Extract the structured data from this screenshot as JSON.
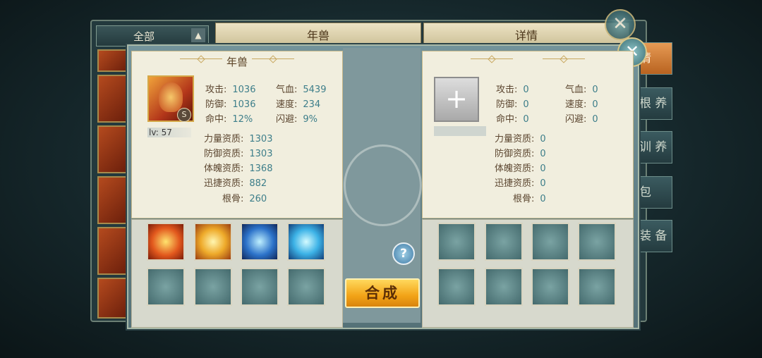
{
  "background": {
    "filter_label": "全部",
    "tab_left": "年兽",
    "tab_right": "详情",
    "side_buttons": [
      "情",
      "根 养",
      "训 养",
      "包",
      "装 备"
    ]
  },
  "left_panel": {
    "title": "年兽",
    "level": "lv: 57",
    "rank": "S",
    "stats": [
      {
        "label": "攻击:",
        "value": "1036"
      },
      {
        "label": "气血:",
        "value": "5439"
      },
      {
        "label": "防御:",
        "value": "1036"
      },
      {
        "label": "速度:",
        "value": "234"
      },
      {
        "label": "命中:",
        "value": "12%"
      },
      {
        "label": "闪避:",
        "value": "9%"
      }
    ],
    "aptitudes": [
      {
        "label": "力量资质:",
        "value": "1303"
      },
      {
        "label": "防御资质:",
        "value": "1303"
      },
      {
        "label": "体魄资质:",
        "value": "1368"
      },
      {
        "label": "迅捷资质:",
        "value": "882"
      },
      {
        "label": "根骨:",
        "value": "260"
      }
    ]
  },
  "right_panel": {
    "add_icon": "+",
    "stats": [
      {
        "label": "攻击:",
        "value": "0"
      },
      {
        "label": "气血:",
        "value": "0"
      },
      {
        "label": "防御:",
        "value": "0"
      },
      {
        "label": "速度:",
        "value": "0"
      },
      {
        "label": "命中:",
        "value": "0"
      },
      {
        "label": "闪避:",
        "value": "0"
      }
    ],
    "aptitudes": [
      {
        "label": "力量资质:",
        "value": "0"
      },
      {
        "label": "防御资质:",
        "value": "0"
      },
      {
        "label": "体魄资质:",
        "value": "0"
      },
      {
        "label": "迅捷资质:",
        "value": "0"
      },
      {
        "label": "根骨:",
        "value": "0"
      }
    ]
  },
  "center": {
    "help_label": "?",
    "combine_label": "合成"
  },
  "close_label": "✕",
  "colors": {
    "accent": "#f2a317",
    "value_text": "#3d7e8a",
    "panel_bg": "#f1eede"
  }
}
